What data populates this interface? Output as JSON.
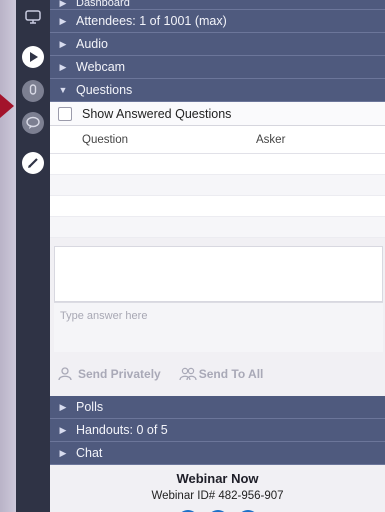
{
  "panel": {
    "sections_top": [
      {
        "label": "Dashboard",
        "expanded": false
      },
      {
        "label": "Attendees: 1 of 1001 (max)",
        "expanded": false
      },
      {
        "label": "Audio",
        "expanded": false
      },
      {
        "label": "Webcam",
        "expanded": false
      },
      {
        "label": "Questions",
        "expanded": true
      }
    ],
    "show_answered_label": "Show Answered Questions",
    "table": {
      "columns": [
        "Question",
        "Asker"
      ]
    },
    "answer_placeholder": "Type answer here",
    "send_privately": "Send Privately",
    "send_to_all": "Send To All",
    "sections_bottom": [
      {
        "label": "Polls",
        "expanded": false
      },
      {
        "label": "Handouts: 0 of 5",
        "expanded": false
      },
      {
        "label": "Chat",
        "expanded": false
      }
    ]
  },
  "footer": {
    "webinar_name": "Webinar Now",
    "webinar_id": "Webinar ID# 482-956-907"
  },
  "icons": {
    "toolbar": [
      "screen-icon",
      "play-icon",
      "microphone-icon",
      "chat-bubble-icon",
      "pen-icon"
    ]
  },
  "colors": {
    "section_bg": "#4f5a7e",
    "toolbar_bg": "#2f3345",
    "arrow": "#a3132b"
  }
}
